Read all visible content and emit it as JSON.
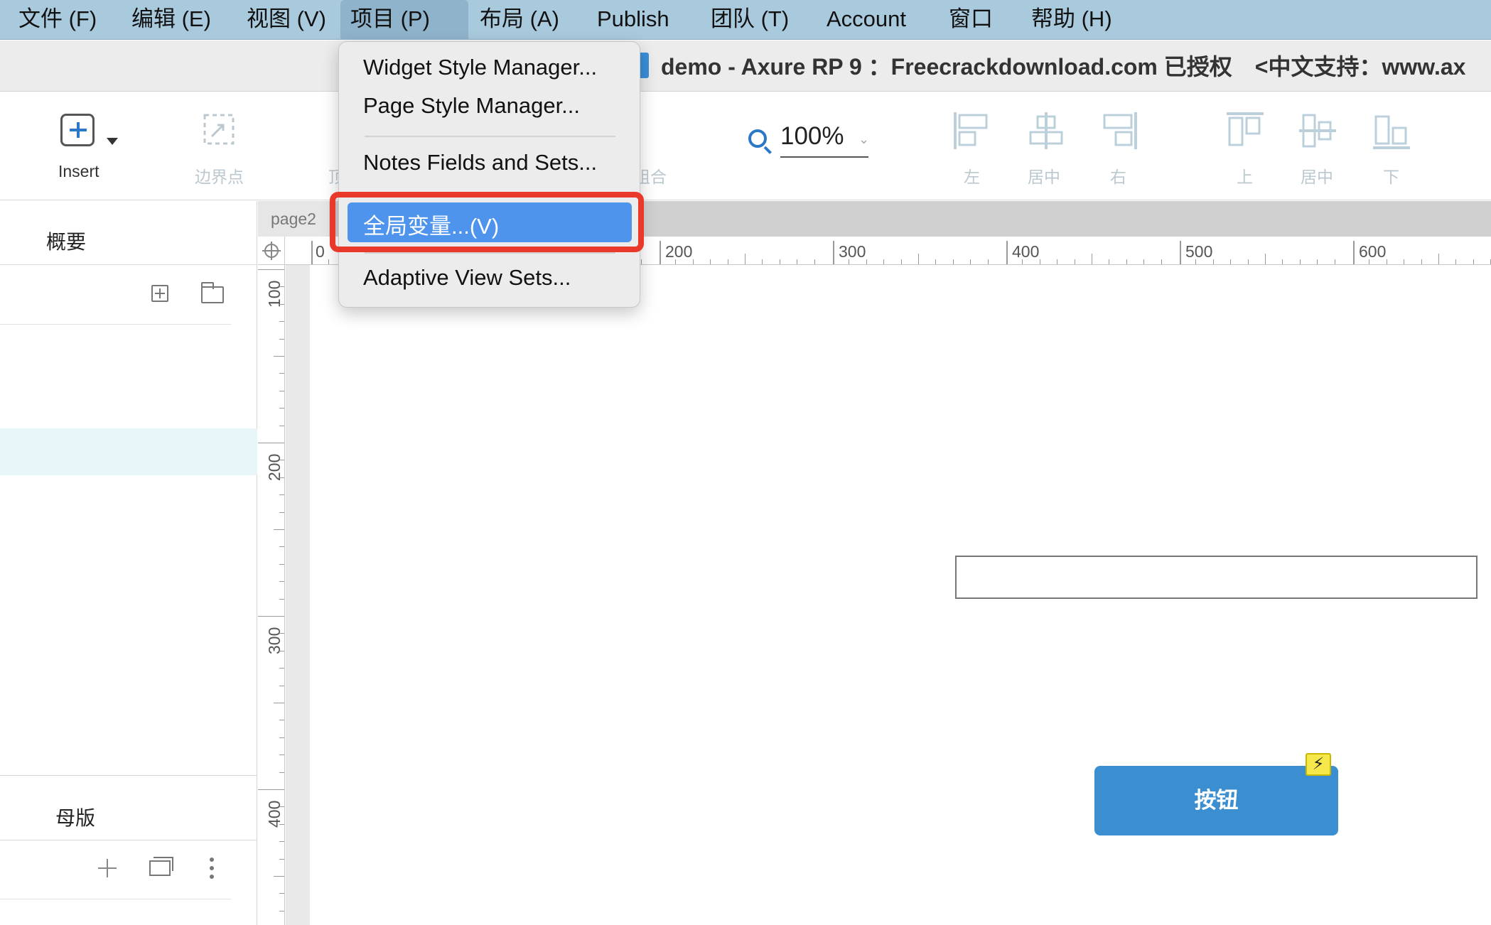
{
  "menubar": {
    "items": [
      "文件 (F)",
      "编辑 (E)",
      "视图 (V)",
      "项目 (P)",
      "布局 (A)",
      "Publish",
      "团队 (T)",
      "Account",
      "窗口",
      "帮助 (H)"
    ],
    "active_index": 3
  },
  "titlebar": {
    "title": "demo - Axure RP 9 ：Freecrackdownload.com 已授权　<中文支持：www.ax"
  },
  "toolbar": {
    "insert_label": "Insert",
    "boundary_label": "边界点",
    "partial_top_label": "顶",
    "group_label": "组合",
    "zoom_value": "100%",
    "align_left": "左",
    "align_center_h": "居中",
    "align_right": "右",
    "align_top": "上",
    "align_center_v": "居中",
    "align_bottom": "下"
  },
  "left_panel": {
    "outline_title": "概要",
    "masters_title": "母版"
  },
  "canvas": {
    "page_tab": "page2",
    "hruler_labels": [
      "0",
      "200",
      "300",
      "400",
      "500",
      "600"
    ],
    "vruler_labels": [
      "100",
      "200",
      "300",
      "400"
    ],
    "button_label": "按钮",
    "interaction_badge": "⚡"
  },
  "dropdown": {
    "items": [
      "Widget Style Manager...",
      "Page Style Manager...",
      "Notes Fields and Sets...",
      "全局变量...(V)",
      "Adaptive View Sets..."
    ],
    "highlighted": "全局变量...(V)"
  },
  "colors": {
    "menubar_bg": "#a9c9dd",
    "highlight_blue": "#4f94ec",
    "callout_red": "#e8392b",
    "widget_button_blue": "#3b8ed0"
  }
}
